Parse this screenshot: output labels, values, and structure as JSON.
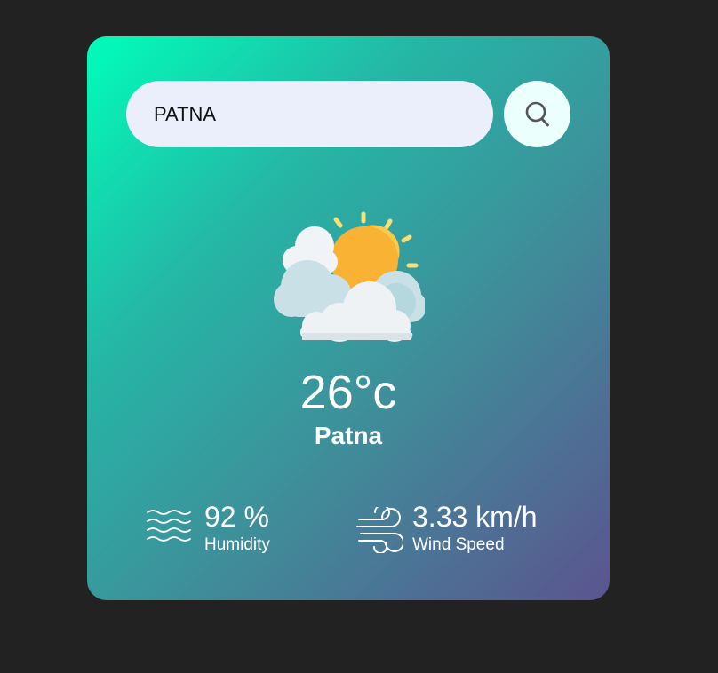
{
  "search": {
    "value": "PATNA",
    "button_icon": "search-icon"
  },
  "weather": {
    "icon": "partly-cloudy-sun-icon",
    "temperature": "26°c",
    "city": "Patna"
  },
  "details": {
    "humidity": {
      "value": "92 %",
      "label": "Humidity",
      "icon": "humidity-waves-icon"
    },
    "wind": {
      "value": "3.33 km/h",
      "label": "Wind Speed",
      "icon": "wind-icon"
    }
  },
  "colors": {
    "background": "#222222",
    "card_gradient_start": "#00feba",
    "card_gradient_end": "#5b548f",
    "input_bg": "#ebeffc",
    "button_bg": "#ebfffc",
    "text": "#ffffff"
  }
}
